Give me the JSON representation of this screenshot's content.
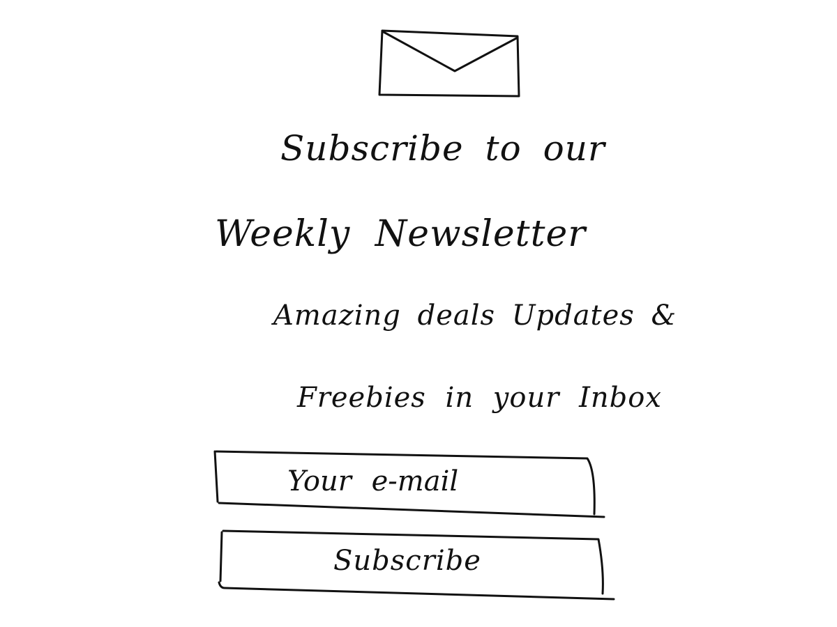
{
  "header": {
    "icon": "envelope-icon"
  },
  "title": {
    "line1": "Subscribe to our",
    "line2": "Weekly Newsletter"
  },
  "subtitle": {
    "line1": "Amazing deals Updates &",
    "line2": "Freebies in your Inbox"
  },
  "form": {
    "email_placeholder": "Your e-mail",
    "email_value": "",
    "subscribe_label": "Subscribe"
  },
  "colors": {
    "ink": "#111111",
    "paper": "#ffffff"
  }
}
